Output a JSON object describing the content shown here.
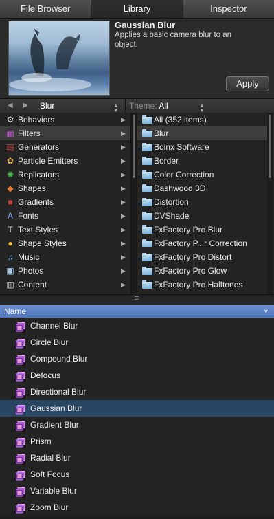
{
  "tabs": [
    "File Browser",
    "Library",
    "Inspector"
  ],
  "active_tab": "Library",
  "preview": {
    "title": "Gaussian Blur",
    "description": "Applies a basic camera blur to an object.",
    "apply_label": "Apply"
  },
  "nav": {
    "back_icon": "triangle-left",
    "forward_icon": "triangle-right",
    "path": "Blur",
    "theme_label": "Theme:",
    "theme_value": "All"
  },
  "categories": [
    {
      "label": "Behaviors",
      "icon": "gear-icon",
      "color": "#d8d8d8"
    },
    {
      "label": "Filters",
      "icon": "filters-icon",
      "color": "#c05ad0",
      "selected": true
    },
    {
      "label": "Generators",
      "icon": "generators-icon",
      "color": "#c94848"
    },
    {
      "label": "Particle Emitters",
      "icon": "particle-icon",
      "color": "#e5b44a"
    },
    {
      "label": "Replicators",
      "icon": "replicator-icon",
      "color": "#4fc24f"
    },
    {
      "label": "Shapes",
      "icon": "shapes-icon",
      "color": "#e57a2f"
    },
    {
      "label": "Gradients",
      "icon": "gradients-icon",
      "color": "#c93a3a"
    },
    {
      "label": "Fonts",
      "icon": "fonts-icon",
      "color": "#7e9bea"
    },
    {
      "label": "Text Styles",
      "icon": "text-styles-icon",
      "color": "#e0e0e0"
    },
    {
      "label": "Shape Styles",
      "icon": "shape-styles-icon",
      "color": "#f0c030"
    },
    {
      "label": "Music",
      "icon": "music-icon",
      "color": "#5ea4e6"
    },
    {
      "label": "Photos",
      "icon": "photos-icon",
      "color": "#9fc8ec"
    },
    {
      "label": "Content",
      "icon": "content-icon",
      "color": "#cfcfcf"
    }
  ],
  "folders": [
    {
      "label": "All (352 items)"
    },
    {
      "label": "Blur",
      "selected": true
    },
    {
      "label": "Boinx Software"
    },
    {
      "label": "Border"
    },
    {
      "label": "Color Correction"
    },
    {
      "label": "Dashwood 3D"
    },
    {
      "label": "Distortion"
    },
    {
      "label": "DVShade"
    },
    {
      "label": "FxFactory Pro Blur"
    },
    {
      "label": "FxFactory P...r Correction"
    },
    {
      "label": "FxFactory Pro Distort"
    },
    {
      "label": "FxFactory Pro Glow"
    },
    {
      "label": "FxFactory Pro Halftones"
    }
  ],
  "list": {
    "header": "Name",
    "items": [
      {
        "label": "Channel Blur"
      },
      {
        "label": "Circle Blur"
      },
      {
        "label": "Compound Blur"
      },
      {
        "label": "Defocus"
      },
      {
        "label": "Directional Blur"
      },
      {
        "label": "Gaussian Blur",
        "selected": true
      },
      {
        "label": "Gradient Blur"
      },
      {
        "label": "Prism"
      },
      {
        "label": "Radial Blur"
      },
      {
        "label": "Soft Focus"
      },
      {
        "label": "Variable Blur"
      },
      {
        "label": "Zoom Blur"
      }
    ]
  },
  "colors": {
    "selection_blue": "#2b4661",
    "header_blue": "#5a7fc8"
  }
}
